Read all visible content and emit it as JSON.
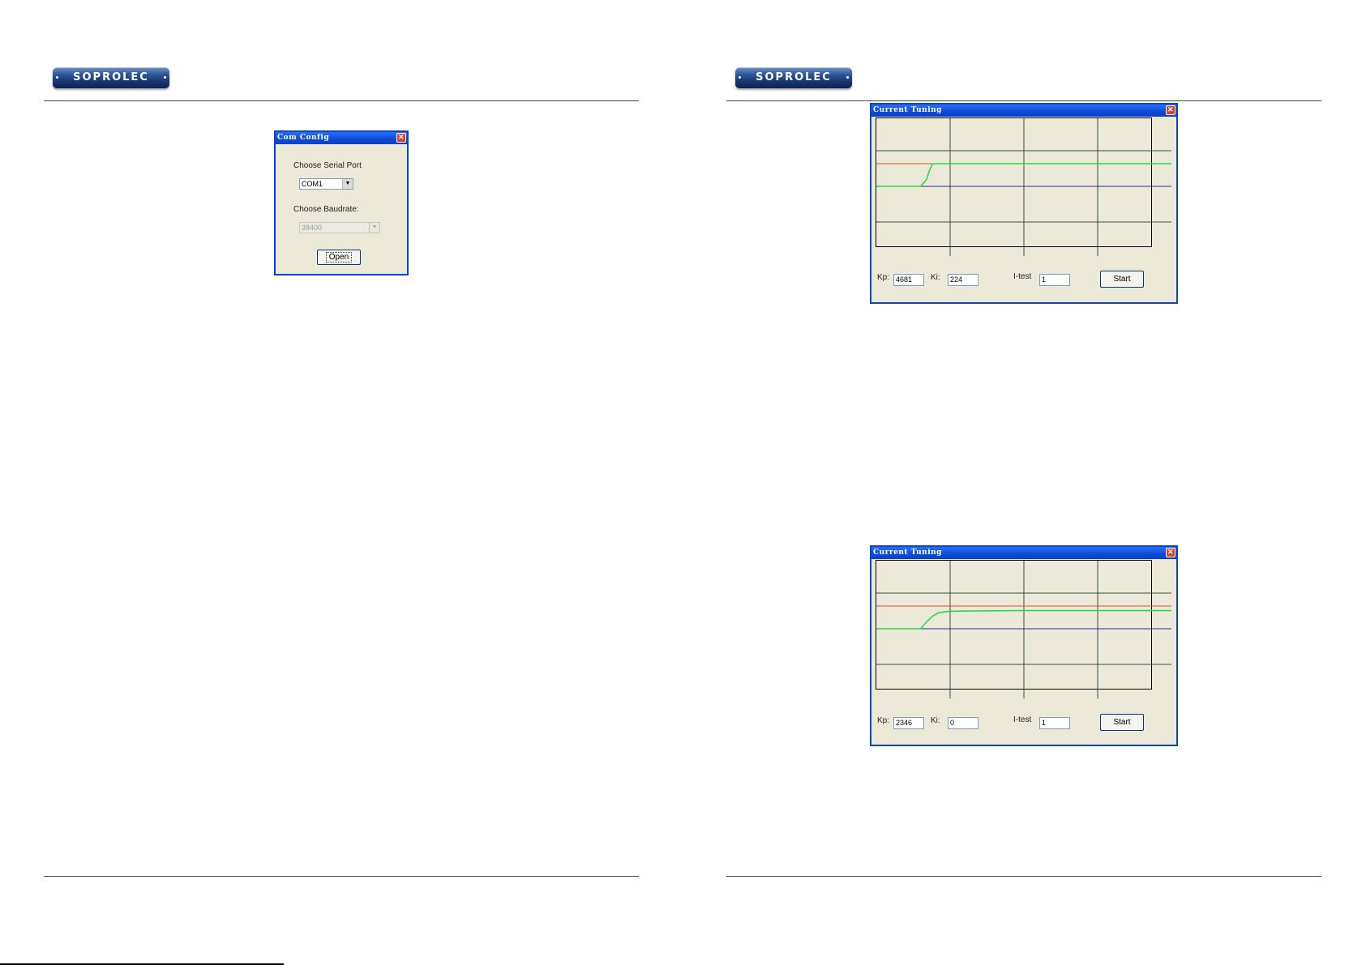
{
  "brand": {
    "logo_text": "SOPROLEC"
  },
  "com_config": {
    "title": "Com Config",
    "serial_port_label": "Choose Serial Port",
    "serial_port_value": "COM1",
    "baudrate_label": "Choose Baudrate:",
    "baudrate_value": "38400",
    "open_button": "Open"
  },
  "tuning_windows": [
    {
      "title": "Current Tuning",
      "kp_label": "Kp:",
      "kp_value": "4681",
      "ki_label": "Ki:",
      "ki_value": "224",
      "itest_label": "I-test",
      "itest_value": "1",
      "start_button": "Start"
    },
    {
      "title": "Current Tuning",
      "kp_label": "Kp:",
      "kp_value": "2346",
      "ki_label": "Ki:",
      "ki_value": "0",
      "itest_label": "I-test",
      "itest_value": "1",
      "start_button": "Start"
    }
  ],
  "chart_data": [
    {
      "type": "line",
      "grid": true,
      "colors": {
        "reference": "#e05030",
        "baseline": "#2030a0",
        "response": "#22dd44",
        "grid": "#2f4f4f"
      },
      "x": [
        0,
        0.15,
        0.17,
        0.18,
        0.19,
        0.2,
        0.3,
        0.5,
        0.7,
        1.0
      ],
      "series": [
        {
          "values": [
            0,
            0,
            0.3,
            0.7,
            0.98,
            1.0,
            1.0,
            1.0,
            1.0,
            1.0
          ]
        }
      ],
      "reference_level": 1.0,
      "baseline_level": 0.0
    },
    {
      "type": "line",
      "grid": true,
      "colors": {
        "reference": "#e05030",
        "baseline": "#2030a0",
        "response": "#22dd44",
        "grid": "#2f4f4f"
      },
      "x": [
        0,
        0.15,
        0.17,
        0.19,
        0.21,
        0.24,
        0.28,
        0.35,
        0.5,
        1.0
      ],
      "series": [
        {
          "values": [
            0,
            0,
            0.3,
            0.55,
            0.7,
            0.76,
            0.78,
            0.79,
            0.8,
            0.8
          ]
        }
      ],
      "reference_level": 1.0,
      "baseline_level": 0.0
    }
  ]
}
